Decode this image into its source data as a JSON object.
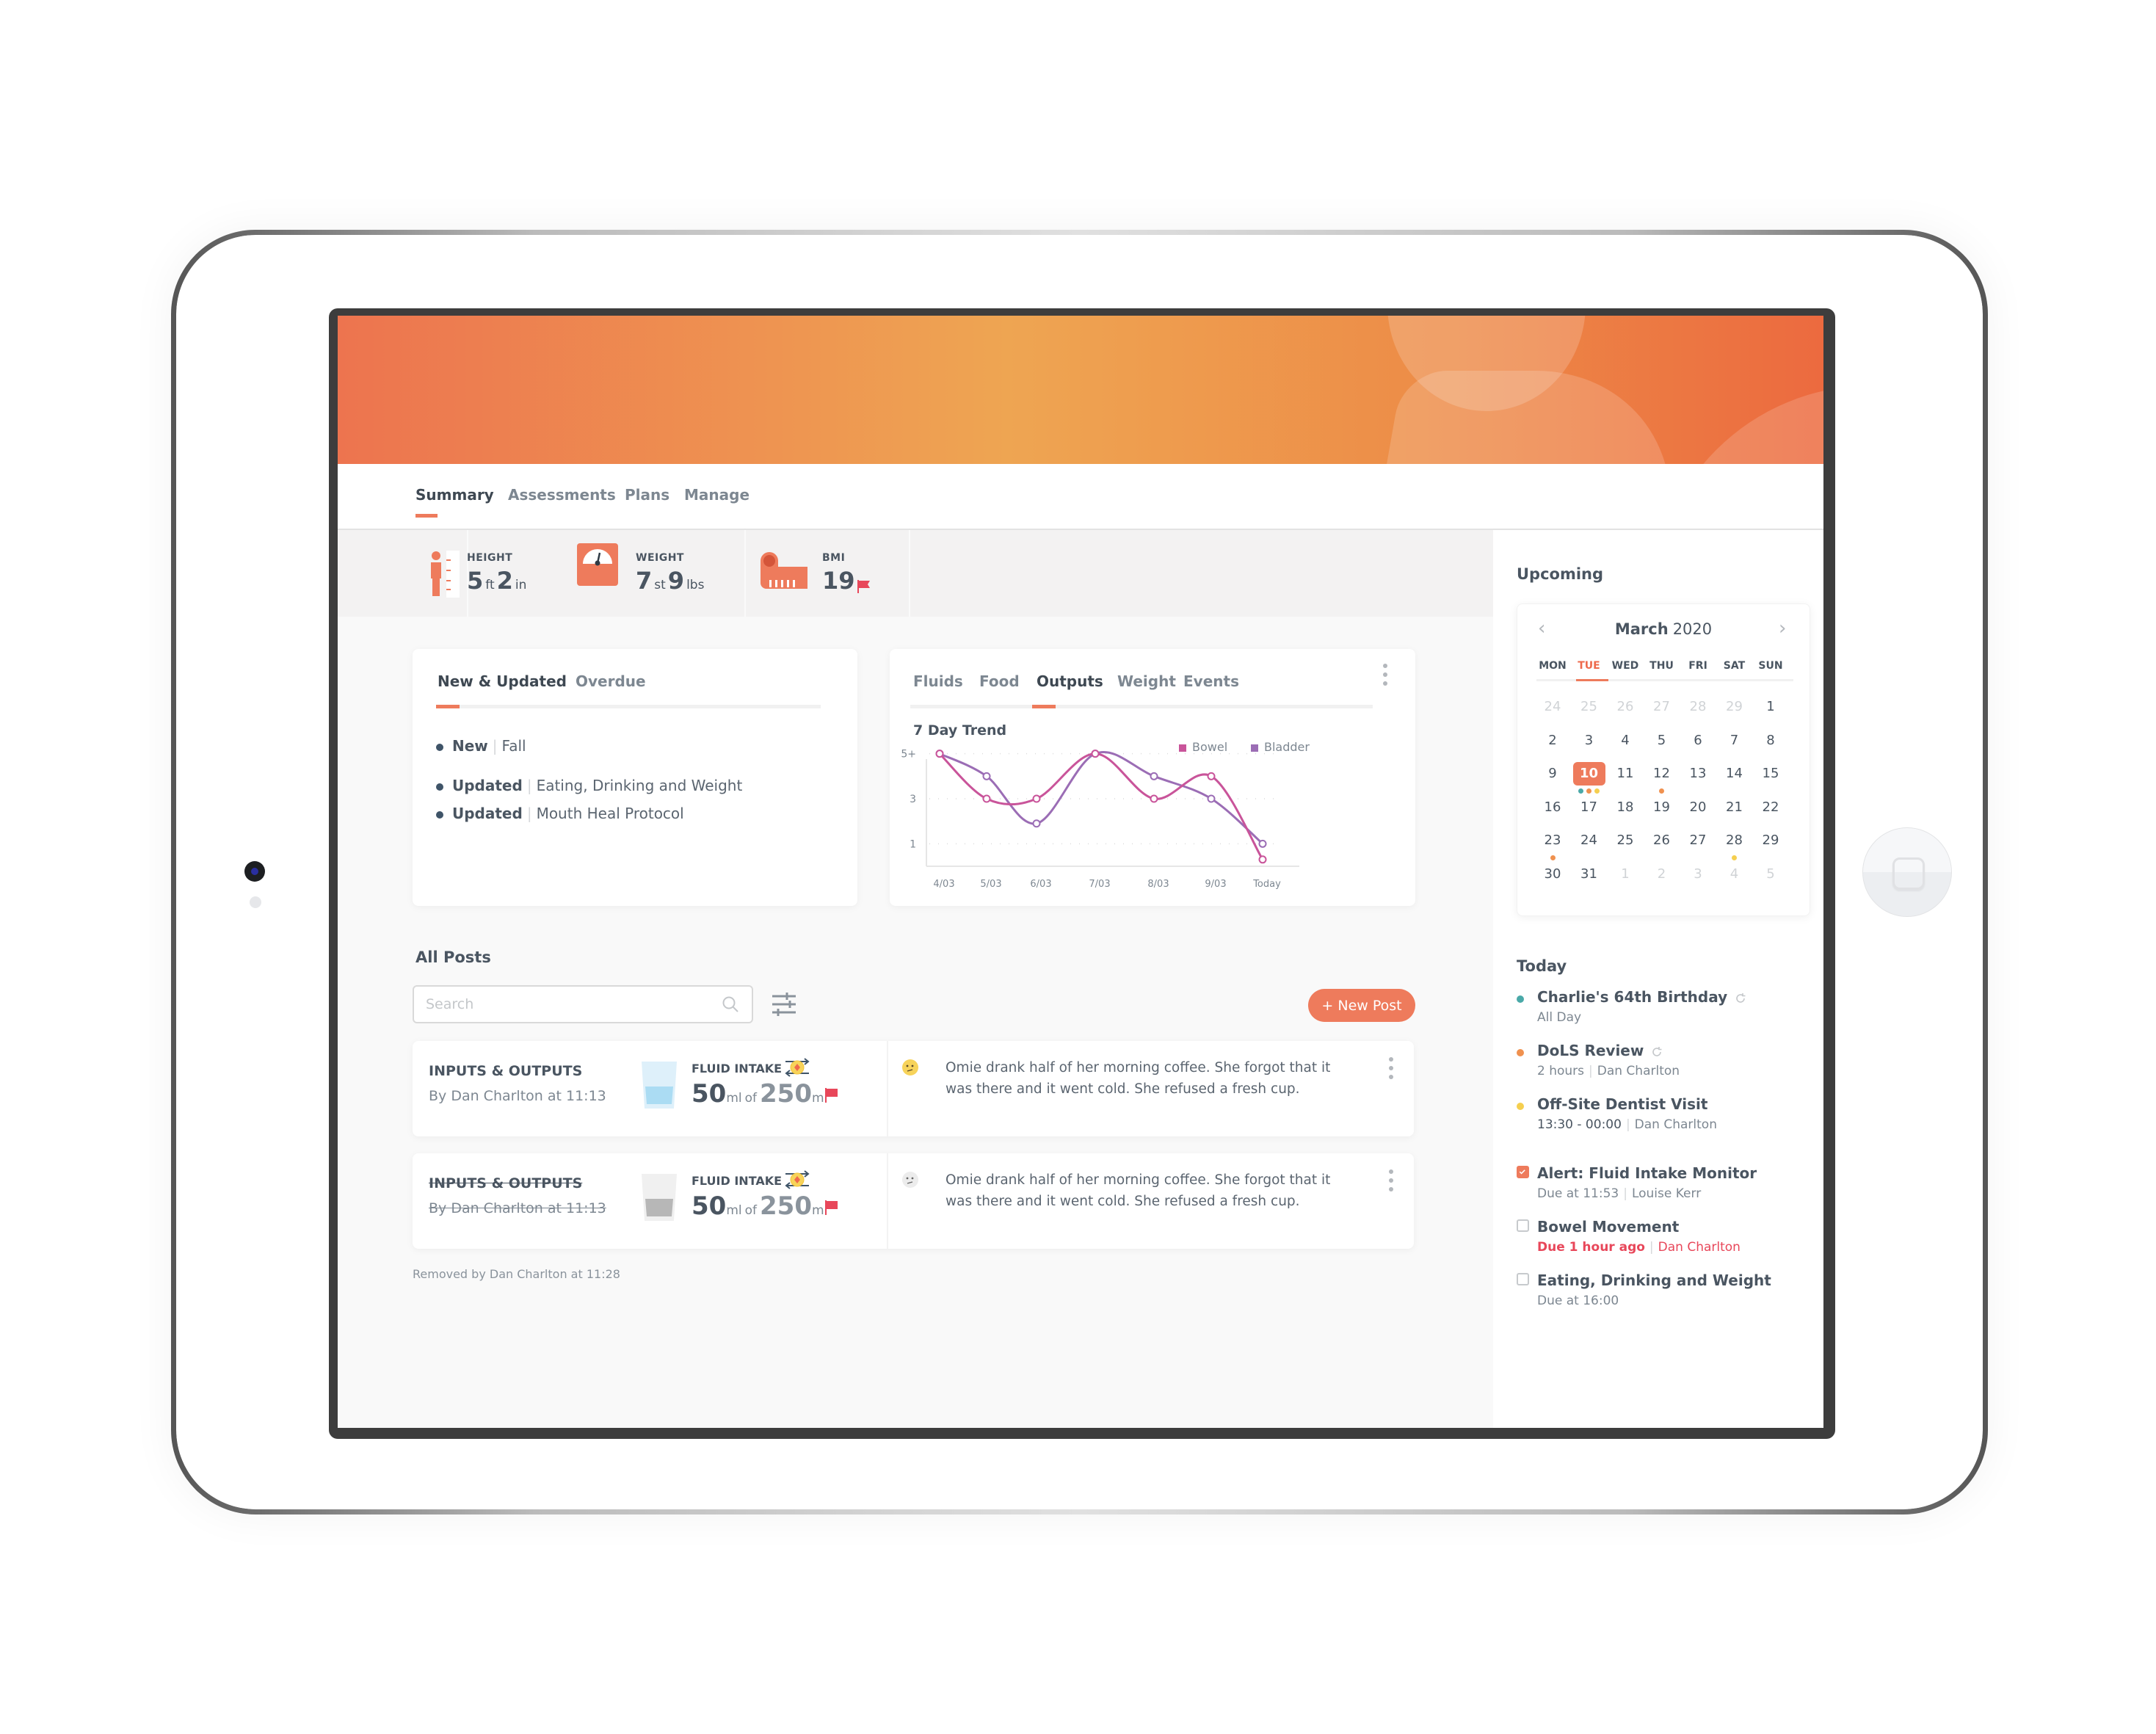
{
  "nav": {
    "tabs": [
      {
        "label": "Summary",
        "active": true
      },
      {
        "label": "Assessments",
        "active": false
      },
      {
        "label": "Plans",
        "active": false
      },
      {
        "label": "Manage",
        "active": false
      }
    ]
  },
  "metrics": {
    "height": {
      "label": "HEIGHT",
      "ft": "5",
      "ft_unit": "ft",
      "in": "2",
      "in_unit": "in"
    },
    "weight": {
      "label": "WEIGHT",
      "st": "7",
      "st_unit": "st",
      "lbs": "9",
      "lbs_unit": "lbs"
    },
    "bmi": {
      "label": "BMI",
      "value": "19",
      "flagged": true
    }
  },
  "updates_card": {
    "tabs": [
      "New & Updated",
      "Overdue"
    ],
    "active_tab": "New & Updated",
    "items": [
      {
        "status": "New",
        "name": "Fall"
      },
      {
        "status": "Updated",
        "name": "Eating, Drinking and Weight"
      },
      {
        "status": "Updated",
        "name": "Mouth Heal Protocol"
      }
    ]
  },
  "trend_card": {
    "tabs": [
      "Fluids",
      "Food",
      "Outputs",
      "Weight",
      "Events"
    ],
    "active_tab": "Outputs",
    "menu_icon": "more-vertical-icon"
  },
  "chart_data": {
    "type": "line",
    "title": "7 Day Trend",
    "x": [
      "4/03",
      "5/03",
      "6/03",
      "7/03",
      "8/03",
      "9/03",
      "Today"
    ],
    "y_ticks": [
      "1",
      "3",
      "5+"
    ],
    "ylim": [
      0,
      6
    ],
    "grid": "horizontal-dotted",
    "legend_position": "top-right",
    "series": [
      {
        "name": "Bowel",
        "color": "#c9549a",
        "values": [
          5,
          3,
          3,
          5,
          3,
          4,
          0.3
        ]
      },
      {
        "name": "Bladder",
        "color": "#9b6db5",
        "values": [
          5,
          4,
          1.9,
          5,
          4,
          3,
          1
        ]
      }
    ]
  },
  "posts": {
    "title": "All Posts",
    "search_placeholder": "Search",
    "search_value": "",
    "new_post_label": "+ New Post",
    "items": [
      {
        "category": "INPUTS & OUTPUTS",
        "author_line": "By Dan Charlton at 11:13",
        "metric_label": "FLUID INTAKE",
        "amount": "50",
        "amount_unit": "ml",
        "of": "of",
        "target": "250",
        "target_unit": "ml",
        "flagged": true,
        "mood": "confused",
        "text": "Omie drank half of her morning coffee. She forgot that it was there and it went cold. She refused a fresh cup.",
        "removed": false
      },
      {
        "category": "INPUTS & OUTPUTS",
        "author_line": "By Dan Charlton at 11:13",
        "metric_label": "FLUID INTAKE",
        "amount": "50",
        "amount_unit": "ml",
        "of": "of",
        "target": "250",
        "target_unit": "ml",
        "flagged": true,
        "mood": "confused",
        "text": "Omie drank half of her morning coffee. She forgot that it was there and it went cold. She refused a fresh cup.",
        "removed": true
      }
    ],
    "removed_note": "Removed by Dan Charlton at 11:28"
  },
  "sidebar": {
    "upcoming_title": "Upcoming",
    "calendar": {
      "month": "March",
      "year": "2020",
      "weekdays": [
        "MON",
        "TUE",
        "WED",
        "THU",
        "FRI",
        "SAT",
        "SUN"
      ],
      "today_weekday": "TUE",
      "selected_day": "10",
      "weeks": [
        [
          "24",
          "25",
          "26",
          "27",
          "28",
          "29",
          "1"
        ],
        [
          "2",
          "3",
          "4",
          "5",
          "6",
          "7",
          "8"
        ],
        [
          "9",
          "10",
          "11",
          "12",
          "13",
          "14",
          "15"
        ],
        [
          "16",
          "17",
          "18",
          "19",
          "20",
          "21",
          "22"
        ],
        [
          "23",
          "24",
          "25",
          "26",
          "27",
          "28",
          "29"
        ],
        [
          "30",
          "31",
          "1",
          "2",
          "3",
          "4",
          "5"
        ]
      ],
      "event_dots": [
        {
          "week": 2,
          "day": 1,
          "colors": [
            "#4aa9a8",
            "#f0914f",
            "#f5cf4f"
          ]
        },
        {
          "week": 2,
          "day": 3,
          "colors": [
            "#f0914f"
          ]
        },
        {
          "week": 4,
          "day": 0,
          "colors": [
            "#f0914f"
          ]
        },
        {
          "week": 4,
          "day": 5,
          "colors": [
            "#f5cf4f"
          ]
        }
      ]
    },
    "today_title": "Today",
    "events": [
      {
        "title": "Charlie's 64th Birthday",
        "sub": "All Day",
        "color": "#4aa9a8",
        "recurring": true
      },
      {
        "title": "DoLS Review",
        "sub_a": "2 hours",
        "sub_b": "Dan Charlton",
        "color": "#f0914f",
        "recurring": true
      },
      {
        "title": "Off-Site Dentist Visit",
        "sub_a": "13:30 - 00:00",
        "sub_b": "Dan Charlton",
        "color": "#f5cf4f",
        "recurring": false
      }
    ],
    "tasks": [
      {
        "title": "Alert: Fluid Intake Monitor",
        "sub_a": "Due at 11:53",
        "sub_b": "Louise Kerr",
        "checked": true,
        "overdue": false
      },
      {
        "title": "Bowel Movement",
        "sub_a": "Due 1 hour ago",
        "sub_b": "Dan Charlton",
        "checked": false,
        "overdue": true
      },
      {
        "title": "Eating, Drinking and Weight",
        "sub_a": "Due at 16:00",
        "checked": false,
        "overdue": false
      }
    ]
  },
  "colors": {
    "accent": "#ee7b5c",
    "alert": "#e8475a",
    "text": "#4a5561",
    "muted": "#7d8791"
  }
}
